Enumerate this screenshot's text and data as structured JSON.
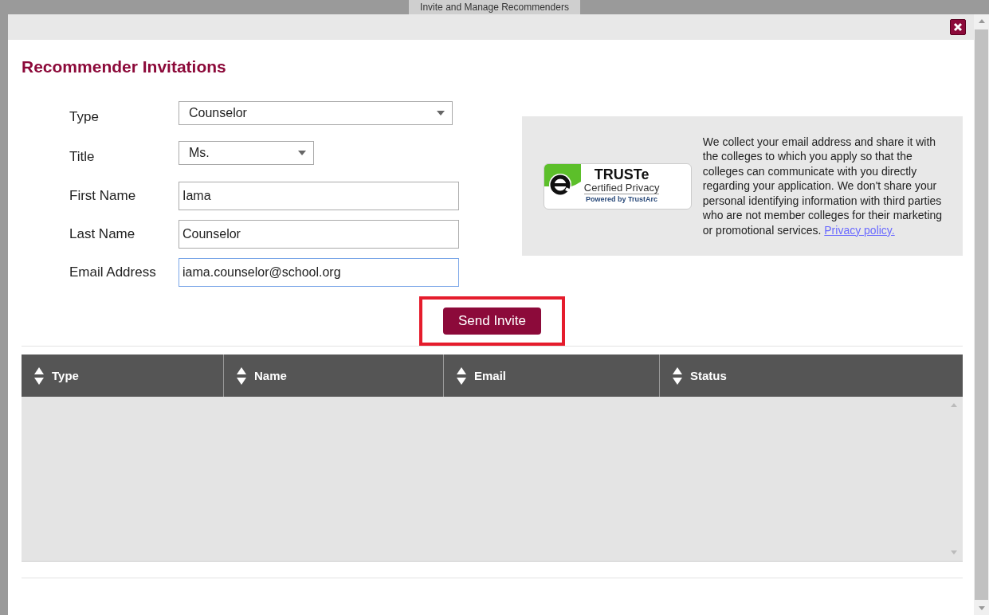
{
  "background_page": {
    "title": "Invite and Manage Recommenders"
  },
  "dialog": {
    "title": "Recommender Invitations"
  },
  "form": {
    "fields": [
      {
        "kind": "select",
        "label": "Type",
        "value": "Counselor",
        "focused": false
      },
      {
        "kind": "select",
        "label": "Title",
        "value": "Ms.",
        "focused": false
      },
      {
        "kind": "text",
        "label": "First Name",
        "value": "Iama",
        "focused": false
      },
      {
        "kind": "text",
        "label": "Last Name",
        "value": "Counselor",
        "focused": false
      },
      {
        "kind": "text",
        "label": "Email Address",
        "value": "iama.counselor@school.org",
        "focused": true
      }
    ],
    "submit": {
      "label": "Send Invite",
      "highlighted": true
    }
  },
  "privacy": {
    "seal": {
      "title": "TRUSTe",
      "subtitle": "Certified Privacy",
      "footer": "Powered by TrustArc"
    },
    "text": "We collect your email address and share it with the colleges to which you apply so that the colleges can communicate with you directly regarding your application. We don't share your personal identifying information with third parties who are not member colleges for their marketing or promotional services.",
    "link": "Privacy policy."
  },
  "table": {
    "columns": [
      "Type",
      "Name",
      "Email",
      "Status"
    ]
  }
}
